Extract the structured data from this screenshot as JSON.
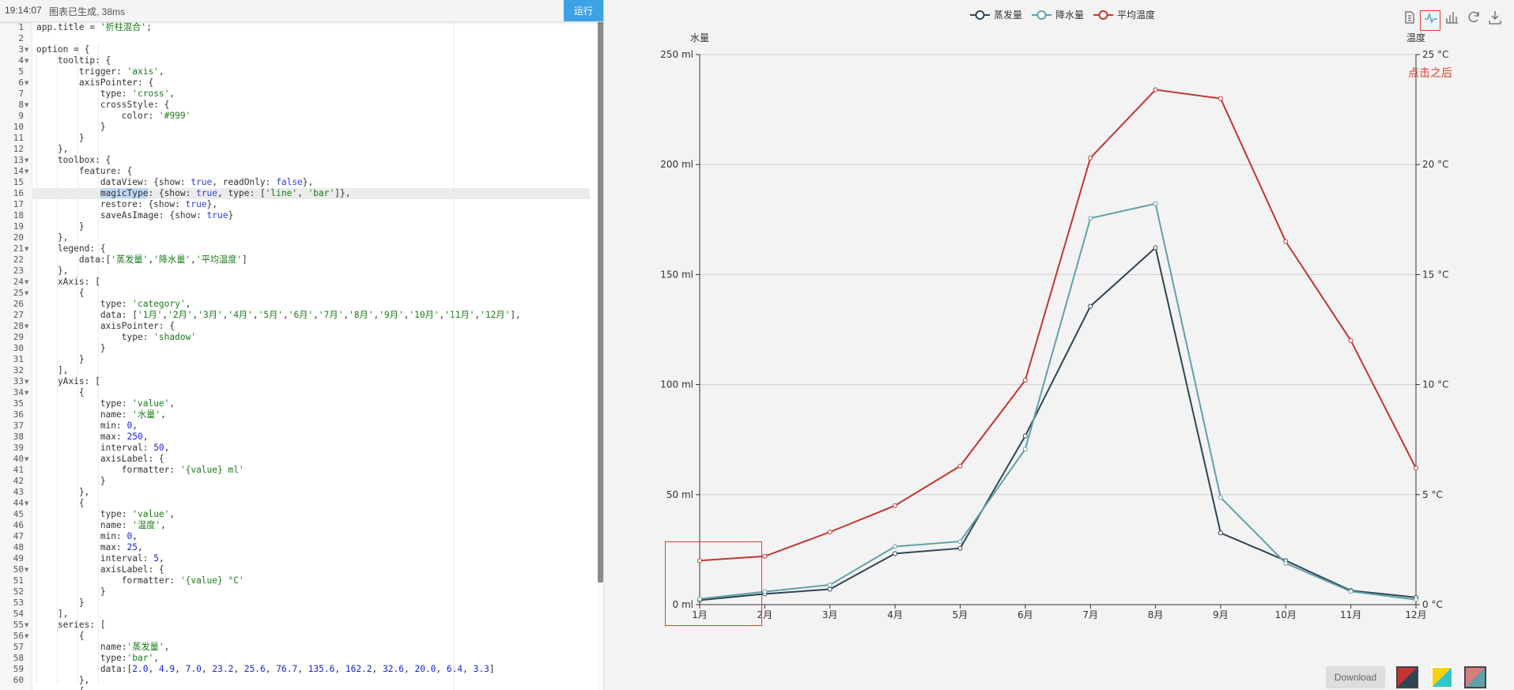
{
  "status": {
    "time": "19:14:07",
    "message": "图表已生成, 38ms",
    "run_label": "运行"
  },
  "editor": {
    "line_numbers": [
      "1",
      "2",
      "3",
      "4",
      "5",
      "6",
      "7",
      "8",
      "9",
      "10",
      "11",
      "12",
      "13",
      "14",
      "15",
      "16",
      "17",
      "18",
      "19",
      "20",
      "21",
      "22",
      "23",
      "24",
      "25",
      "26",
      "27",
      "28",
      "29",
      "30",
      "31",
      "32",
      "33",
      "34",
      "35",
      "36",
      "37",
      "38",
      "39",
      "40",
      "41",
      "42",
      "43",
      "44",
      "45",
      "46",
      "47",
      "48",
      "49",
      "50",
      "51",
      "52",
      "53",
      "54",
      "55",
      "56",
      "57",
      "58",
      "59",
      "60"
    ],
    "foldable_lines": [
      3,
      4,
      6,
      8,
      13,
      14,
      21,
      24,
      25,
      28,
      33,
      34,
      40,
      44,
      50,
      55,
      56
    ],
    "active_line": 16,
    "lines": [
      "app.title = '折柱混合';",
      "",
      "option = {",
      "    tooltip: {",
      "        trigger: 'axis',",
      "        axisPointer: {",
      "            type: 'cross',",
      "            crossStyle: {",
      "                color: '#999'",
      "            }",
      "        }",
      "    },",
      "    toolbox: {",
      "        feature: {",
      "            dataView: {show: true, readOnly: false},",
      "            magicType: {show: true, type: ['line', 'bar']},",
      "            restore: {show: true},",
      "            saveAsImage: {show: true}",
      "        }",
      "    },",
      "    legend: {",
      "        data:['蒸发量','降水量','平均温度']",
      "    },",
      "    xAxis: [",
      "        {",
      "            type: 'category',",
      "            data: ['1月','2月','3月','4月','5月','6月','7月','8月','9月','10月','11月','12月'],",
      "            axisPointer: {",
      "                type: 'shadow'",
      "            }",
      "        }",
      "    ],",
      "    yAxis: [",
      "        {",
      "            type: 'value',",
      "            name: '水量',",
      "            min: 0,",
      "            max: 250,",
      "            interval: 50,",
      "            axisLabel: {",
      "                formatter: '{value} ml'",
      "            }",
      "        },",
      "        {",
      "            type: 'value',",
      "            name: '温度',",
      "            min: 0,",
      "            max: 25,",
      "            interval: 5,",
      "            axisLabel: {",
      "                formatter: '{value} °C'",
      "            }",
      "        }",
      "    ],",
      "    series: [",
      "        {",
      "            name:'蒸发量',",
      "            type:'bar',",
      "            data:[2.0, 4.9, 7.0, 23.2, 25.6, 76.7, 135.6, 162.2, 32.6, 20.0, 6.4, 3.3]",
      "        },",
      "        {"
    ]
  },
  "toolbox": {
    "icons": [
      "data-view-icon",
      "magic-line-icon",
      "magic-bar-icon",
      "restore-icon",
      "save-as-image-icon"
    ]
  },
  "annotation": {
    "after_click": "点击之后"
  },
  "download_label": "Download",
  "themes": [
    "theme-swatch-1",
    "theme-swatch-2",
    "theme-swatch-3"
  ],
  "chart_data": {
    "type": "line",
    "title": "",
    "categories": [
      "1月",
      "2月",
      "3月",
      "4月",
      "5月",
      "6月",
      "7月",
      "8月",
      "9月",
      "10月",
      "11月",
      "12月"
    ],
    "y_left": {
      "name": "水量",
      "min": 0,
      "max": 250,
      "interval": 50,
      "tick_labels": [
        "0 ml",
        "50 ml",
        "100 ml",
        "150 ml",
        "200 ml",
        "250 ml"
      ]
    },
    "y_right": {
      "name": "温度",
      "min": 0,
      "max": 25,
      "interval": 5,
      "tick_labels": [
        "0 °C",
        "5 °C",
        "10 °C",
        "15 °C",
        "20 °C",
        "25 °C"
      ]
    },
    "legend": {
      "position": "top-center",
      "entries": [
        "蒸发量",
        "降水量",
        "平均温度"
      ]
    },
    "grid": true,
    "series": [
      {
        "name": "蒸发量",
        "axis": "left",
        "color": "#2f4554",
        "values": [
          2.0,
          4.9,
          7.0,
          23.2,
          25.6,
          76.7,
          135.6,
          162.2,
          32.6,
          20.0,
          6.4,
          3.3
        ]
      },
      {
        "name": "降水量",
        "axis": "left",
        "color": "#61a0a8",
        "values": [
          2.6,
          5.9,
          9.0,
          26.4,
          28.7,
          70.7,
          175.6,
          182.2,
          48.7,
          18.8,
          6.0,
          2.3
        ]
      },
      {
        "name": "平均温度",
        "axis": "right",
        "color": "#c23531",
        "values": [
          2.0,
          2.2,
          3.3,
          4.5,
          6.3,
          10.2,
          20.3,
          23.4,
          23.0,
          16.5,
          12.0,
          6.2
        ]
      }
    ]
  }
}
